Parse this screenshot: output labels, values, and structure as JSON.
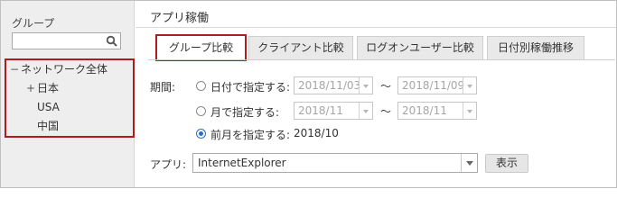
{
  "sidebar": {
    "title": "グループ",
    "search": {
      "value": "",
      "placeholder": ""
    },
    "tree": [
      {
        "toggle": "−",
        "label": "ネットワーク全体"
      },
      {
        "toggle": "+",
        "label": "日本"
      },
      {
        "toggle": "",
        "label": "USA"
      },
      {
        "toggle": "",
        "label": "中国"
      }
    ]
  },
  "main": {
    "title": "アプリ稼働",
    "tabs": [
      {
        "label": "グループ比較",
        "active": true
      },
      {
        "label": "クライアント比較",
        "active": false
      },
      {
        "label": "ログオンユーザー比較",
        "active": false
      },
      {
        "label": "日付別稼働推移",
        "active": false
      }
    ],
    "period": {
      "label": "期間:",
      "by_date": {
        "label": "日付で指定する:",
        "from": "2018/11/03",
        "to": "2018/11/09",
        "selected": false
      },
      "by_month": {
        "label": "月で指定する:",
        "from": "2018/11",
        "to": "2018/11",
        "selected": false
      },
      "prev_month": {
        "label": "前月を指定する:",
        "value": "2018/10",
        "selected": true
      },
      "range_separator": "〜"
    },
    "app": {
      "label": "アプリ:",
      "selected": "InternetExplorer",
      "show_button": "表示"
    }
  },
  "colors": {
    "highlight_border": "#b01c1c",
    "radio_selected": "#2b6fc4",
    "sidebar_bg": "#eeeeee"
  }
}
